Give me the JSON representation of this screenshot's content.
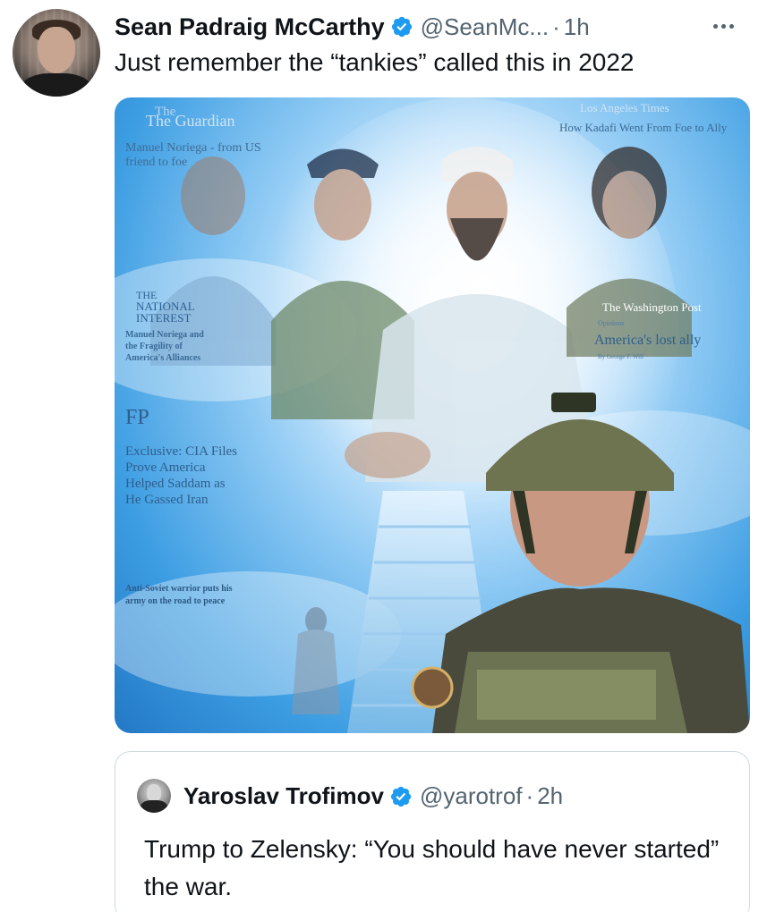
{
  "tweet": {
    "author_name": "Sean Padraig McCarthy",
    "handle": "@SeanMc...",
    "separator": "·",
    "time": "1h",
    "text": "Just remember the “tankies” called this in 2022"
  },
  "media": {
    "clippings": {
      "guardian_masthead": "The Guardian",
      "guardian_headline_1": "Manuel Noriega - from US",
      "guardian_headline_2": "friend to foe",
      "lat_masthead": "Los Angeles Times",
      "lat_headline": "How Kadafi Went From Foe to Ally",
      "ni_masthead_1": "THE",
      "ni_masthead_2": "NATIONAL",
      "ni_masthead_3": "INTEREST",
      "ni_headline_1": "Manuel Noriega and",
      "ni_headline_2": "the Fragility of",
      "ni_headline_3": "America's Alliances",
      "wapo_masthead": "The Washington Post",
      "wapo_section": "Opinions",
      "wapo_headline": "America's lost ally",
      "wapo_byline": "By George F. Will",
      "fp_masthead": "FP",
      "fp_headline_1": "Exclusive: CIA Files",
      "fp_headline_2": "Prove America",
      "fp_headline_3": "Helped Saddam as",
      "fp_headline_4": "He Gassed Iran",
      "old_headline_1": "Anti-Soviet warrior puts his",
      "old_headline_2": "army on the road to peace"
    }
  },
  "quote": {
    "author_name": "Yaroslav Trofimov",
    "handle": "@yarotrof",
    "separator": "·",
    "time": "2h",
    "text": "Trump to Zelensky: “You should have never started” the war."
  },
  "colors": {
    "verified": "#1d9bf0",
    "text": "#0f1419",
    "secondary": "#536471",
    "border": "#cfd9de"
  }
}
